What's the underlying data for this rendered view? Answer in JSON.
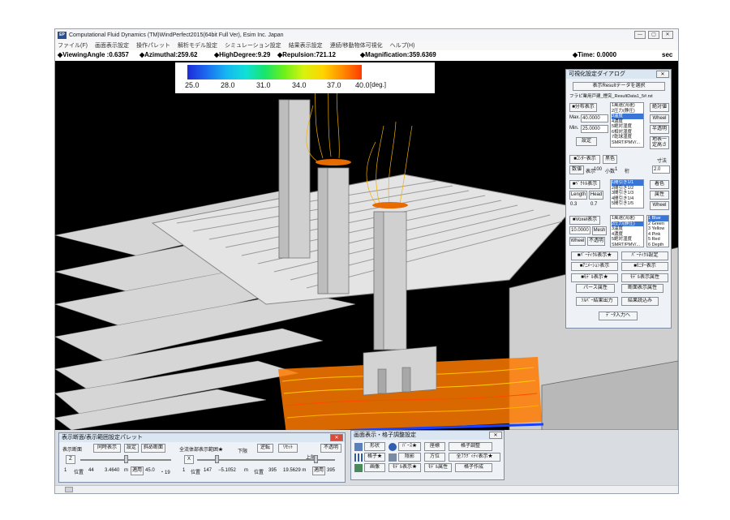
{
  "window": {
    "title": "Computational Fluid Dynamics (TM)WindPerfect2015(64bit Full Ver), Esim Inc. Japan",
    "logo": "EP",
    "controls": [
      "—",
      "▢",
      "✕"
    ]
  },
  "menu": [
    "ファイル(F)",
    "画面表示設定",
    "操作パレット",
    "解析モデル設定",
    "シミュレーション設定",
    "結果表示設定",
    "連続/移動物体可視化",
    "ヘルプ(H)"
  ],
  "status": {
    "viewing_angle": "◆ViewingAngle :0.6357",
    "azimuthal": "◆Azimuthal:259.62",
    "high_degree": "◆HighDegree:9.29",
    "repulsion": "◆Repulsion:721.12",
    "magnification": "◆Magnification:359.6369",
    "time": "◆Time: 0.0000",
    "time_unit": "sec"
  },
  "colorbar": {
    "ticks": [
      "25.0",
      "28.0",
      "31.0",
      "34.0",
      "37.0",
      "40.0"
    ],
    "unit": "[deg.]",
    "range": [
      25,
      40
    ]
  },
  "viz_dialog": {
    "title": "可視化設定ダイアログ",
    "close": "✕",
    "select_result": "表示Resultデータを選択",
    "file": "フラピ業用戸建_煙突_ResultData1_5#.rst",
    "dist_btn": "■分布表示",
    "max_label": "Max.",
    "max_value": "40.0000",
    "min_label": "Min.",
    "min_value": "25.0000",
    "set_btn": "設定",
    "dist_list": [
      "1風速(流速)",
      "2圧力(静圧)",
      "3温度",
      "4濃度",
      "5絶対湿度",
      "6相対湿度",
      "7乾球湿度",
      "SMRT/PMV/..."
    ],
    "dist_selected": 2,
    "abs_btn": "絶対値",
    "wheel_btn": "Wheel",
    "trans_btn": "半透明",
    "ground_btn": "地表一定高さ",
    "contour_btn": "■ｺﾝﾀｰ表示",
    "black_btn": "黒色",
    "dim_label": "寸法",
    "num_btn": "数値",
    "disp_label": "表示",
    "disp_val": "100",
    "dec_label": "小数",
    "dec_val": "1",
    "digit_label": "桁",
    "digit_val": "2.0",
    "vector_btn": "■ﾍﾞｸﾄﾙ表示",
    "length_btn": "Length",
    "head_btn": "Head",
    "len_val": "0.3",
    "head_val": "0.7",
    "vector_list": [
      "1間引き1/1",
      "2間引き1/2",
      "3間引き1/3",
      "4間引き1/4",
      "5間引き1/5"
    ],
    "vector_selected": 0,
    "color_btn": "着色",
    "attr_btn": "属性",
    "wheel2_btn": "Wheel",
    "voxel_btn": "■Voxel表示",
    "voxel_val": "10.0000",
    "mesh_btn": "Mesh",
    "wheel3_btn": "Wheel",
    "opaque_btn": "不透明",
    "voxel_list": [
      "1風速(流速)",
      "2圧力(静圧)",
      "3温度",
      "4濃度",
      "5絶対湿度",
      "SMRT/PMV/..."
    ],
    "voxel_selected": 1,
    "color_list": [
      "1 Blue",
      "2 Green",
      "3 Yellow",
      "4 Pink",
      "5 Red",
      "6 Depth"
    ],
    "color_selected": 0,
    "particle_btn": "■ﾊﾟｰﾃｨｸﾙ表示★",
    "particle_set_btn": "ﾊﾟｰﾃｨｸﾙ設定",
    "anim_btn": "■ｱﾆﾒｰｼｮﾝ表示",
    "monitor_btn": "■ﾓﾆﾀｰ表示",
    "model_btn": "■ﾓﾃﾞﾙ表示★",
    "model_attr_btn": "ﾓﾃﾞﾙ表示属性",
    "path_attr_btn": "パース属性",
    "section_attr_btn": "断面表示属性",
    "solver_btn": "ｿﾙﾊﾞｰ結果出力",
    "result_btn": "結果読込み",
    "data_in_btn": "ﾃﾞｰﾀ入力へ"
  },
  "section_palette": {
    "title": "表示断面/表示範囲設定パレット",
    "close": "✕",
    "section_label": "表示断面",
    "sim_btn": "同時表示",
    "set_btn": "設定",
    "oblique_btn": "斜め断面",
    "range_label": "全流体部表示範囲★",
    "lower_label": "下限",
    "upper_label": "上限",
    "invert_btn": "逆転",
    "reset_btn": "ﾘｾｯﾄ",
    "opaque_btn": "不透明",
    "z_label": "Z",
    "x_label": "X",
    "row1": [
      "1",
      "位置",
      "44",
      "3.4640",
      "m",
      "適用",
      "45.0",
      "・19"
    ],
    "row2": [
      "1",
      "位置",
      "147",
      "−5.1052",
      "m",
      "位置",
      "395",
      "19.5629 m",
      "適用",
      "395"
    ]
  },
  "grid_palette": {
    "title": "画面表示・格子調整設定",
    "close": "✕",
    "buttons": [
      [
        "形状",
        "ﾊﾟｰｽ★",
        "座標",
        "格子調整"
      ],
      [
        "格子★",
        "陰影",
        "方位",
        "全ﾌﾗｸﾞｨﾃｨ表示★"
      ],
      [
        "画像",
        "ﾓﾃﾞﾙ表示★",
        "ﾓﾃﾞﾙ属性",
        "格子作成"
      ]
    ]
  }
}
